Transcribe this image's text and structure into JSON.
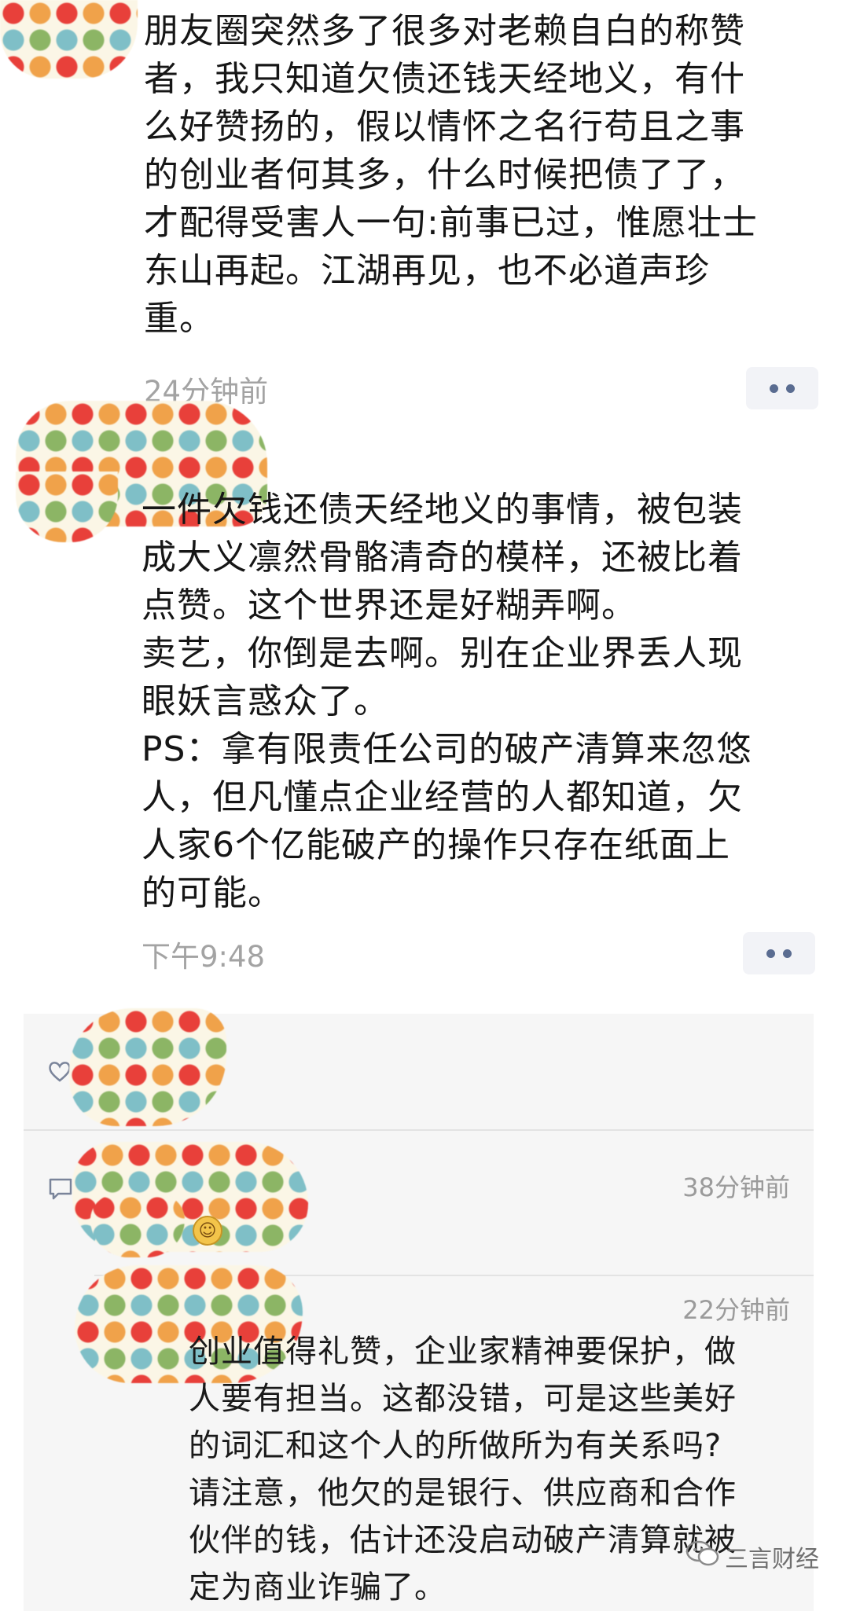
{
  "posts": [
    {
      "text": "朋友圈突然多了很多对老赖自白的称赞\n者，我只知道欠债还钱天经地义，有什\n么好赞扬的，假以情怀之名行苟且之事\n的创业者何其多，什么时候把债了了，\n才配得受害人一句:前事已过，惟愿壮士\n东山再起。江湖再见，也不必道声珍\n重。",
      "time": "24分钟前"
    },
    {
      "text": "一件欠钱还债天经地义的事情，被包装\n成大义凛然骨骼清奇的模样，还被比着\n点赞。这个世界还是好糊弄啊。\n卖艺，你倒是去啊。别在企业界丢人现\n眼妖言惑众了。\nPS：拿有限责任公司的破产清算来忽悠\n人，但凡懂点企业经营的人都知道，欠\n人家6个亿能破产的操作只存在纸面上\n的可能。",
      "time": "下午9:48"
    }
  ],
  "comments": [
    {
      "time": "38分钟前",
      "text": ""
    },
    {
      "time": "22分钟前",
      "text": "创业值得礼赞，企业家精神要保护，做\n人要有担当。这都没错，可是这些美好\n的词汇和这个人的所做所为有关系吗?\n请注意，他欠的是银行、供应商和合作\n伙伴的钱，估计还没启动破产清算就被\n定为商业诈骗了。"
    }
  ],
  "watermark": {
    "label": "三言财经"
  },
  "icons": {
    "more": "more-dots-icon",
    "like": "heart-icon",
    "comment": "comment-bubble-icon",
    "emoji": "thinking-face-emoji-icon",
    "watermark": "wechat-official-account-icon"
  },
  "colors": {
    "link_blue": "#5a6c91",
    "time_gray": "#a3a3a3",
    "panel_bg": "#f6f6f6"
  }
}
